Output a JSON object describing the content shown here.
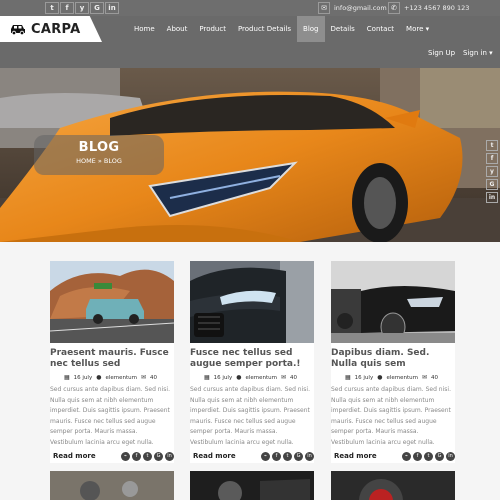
{
  "topbar": {
    "social": [
      "t",
      "f",
      "y",
      "G",
      "in"
    ],
    "email": "info@gmail.com",
    "phone": "+123 4567 890 123"
  },
  "nav": {
    "logo_text": "CARPA",
    "links": [
      "Home",
      "About",
      "Product",
      "Product Details",
      "Blog",
      "Details",
      "Contact",
      "More ▾"
    ],
    "active": "Blog",
    "sign_up": "Sign Up",
    "sign_in": "Sign in ▾"
  },
  "hero": {
    "title": "BLOG",
    "crumb_home": "HOME",
    "crumb_current": "» BLOG",
    "side_icons": [
      "t",
      "f",
      "y",
      "G",
      "in"
    ]
  },
  "colors": {
    "topbar": "#6e6e6e",
    "nav": "#6a6a6a",
    "active_tab": "#8e8e8e",
    "car_orange": "#e8871a"
  },
  "cards": [
    {
      "title": "Praesent mauris. Fusce nec tellus sed",
      "date": "16 july",
      "author": "elementum",
      "comments": "40",
      "excerpt": "Sed cursus ante dapibus diam. Sed nisi. Nulla quis sem at nibh elementum imperdiet. Duis sagittis ipsum. Praesent mauris. Fusce nec tellus sed augue semper porta. Mauris massa. Vestibulum lacinia arcu eget nulla.",
      "read_more": "Read more"
    },
    {
      "title": "Fusce nec tellus sed augue semper porta.!",
      "date": "16 july",
      "author": "elementum",
      "comments": "40",
      "excerpt": "Sed cursus ante dapibus diam. Sed nisi. Nulla quis sem at nibh elementum imperdiet. Duis sagittis ipsum. Praesent mauris. Fusce nec tellus sed augue semper porta. Mauris massa. Vestibulum lacinia arcu eget nulla.",
      "read_more": "Read more"
    },
    {
      "title": "Dapibus diam. Sed. Nulla quis sem",
      "date": "16 july",
      "author": "elementum",
      "comments": "40",
      "excerpt": "Sed cursus ante dapibus diam. Sed nisi. Nulla quis sem at nibh elementum imperdiet. Duis sagittis ipsum. Praesent mauris. Fusce nec tellus sed augue semper porta. Mauris massa. Vestibulum lacinia arcu eget nulla.",
      "read_more": "Read more"
    }
  ],
  "card_share": [
    "rss",
    "f",
    "t",
    "G+",
    "in"
  ],
  "meta_icons": {
    "date": "calendar-icon",
    "author": "user-icon",
    "comments": "comment-icon"
  }
}
